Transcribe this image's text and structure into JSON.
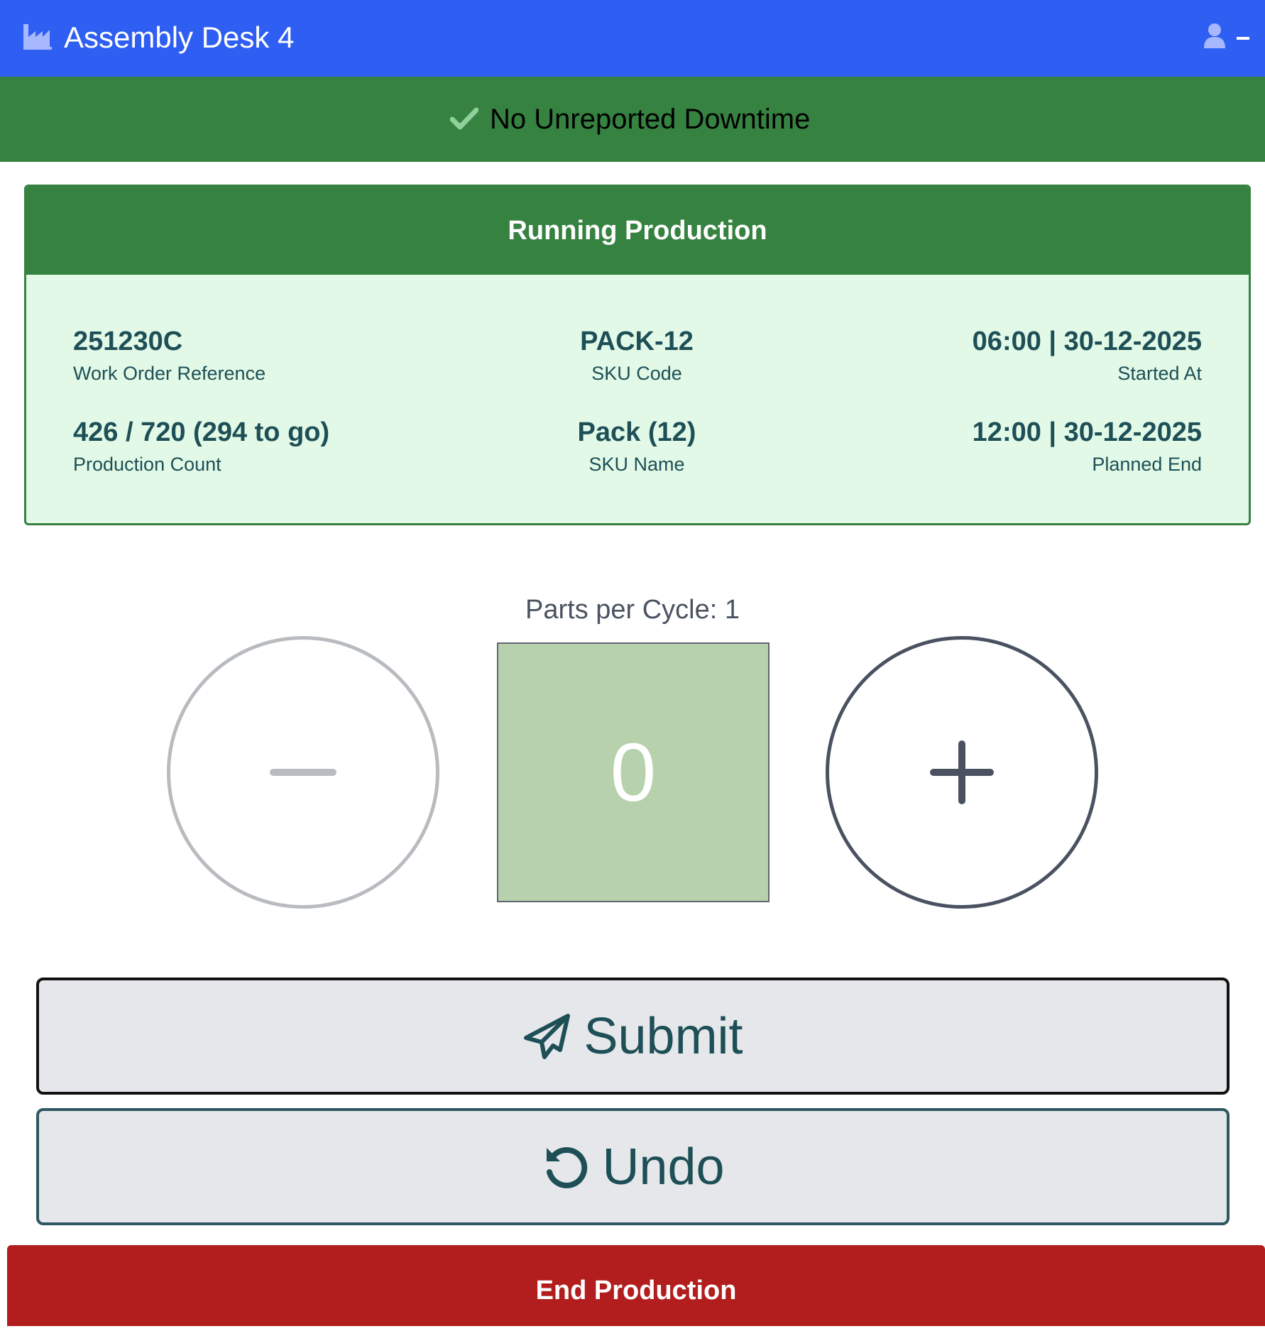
{
  "header": {
    "title": "Assembly Desk 4",
    "icon": "factory-icon",
    "user_icon": "user-icon"
  },
  "banner": {
    "icon": "check-icon",
    "text": "No Unreported Downtime"
  },
  "production": {
    "title": "Running Production",
    "fields": {
      "work_order": {
        "value": "251230C",
        "label": "Work Order Reference"
      },
      "sku_code": {
        "value": "PACK-12",
        "label": "SKU Code"
      },
      "started_at": {
        "value": "06:00 | 30-12-2025",
        "label": "Started At"
      },
      "production_count": {
        "value": "426 / 720 (294 to go)",
        "label": "Production Count"
      },
      "sku_name": {
        "value": "Pack (12)",
        "label": "SKU Name"
      },
      "planned_end": {
        "value": "12:00 | 30-12-2025",
        "label": "Planned End"
      }
    }
  },
  "counter": {
    "cycle_label": "Parts per Cycle: 1",
    "value": "0",
    "minus_icon": "minus-icon",
    "plus_icon": "plus-icon"
  },
  "actions": {
    "submit_label": "Submit",
    "submit_icon": "paper-plane-icon",
    "undo_label": "Undo",
    "undo_icon": "undo-icon",
    "end_label": "End Production"
  },
  "colors": {
    "header": "#2f5ef2",
    "success": "#368241",
    "card_bg": "#e1f9e6",
    "counter_bg": "#b8d1ad",
    "danger": "#b21d1d"
  }
}
